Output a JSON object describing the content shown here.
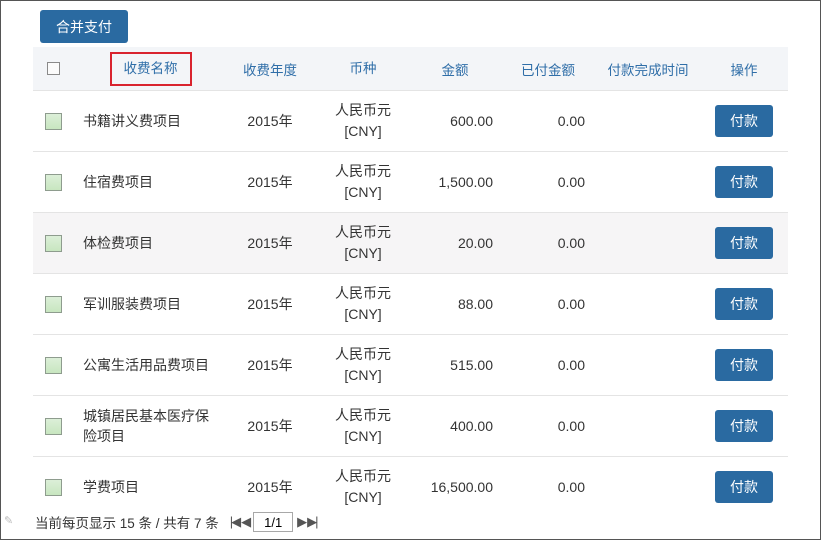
{
  "toolbar": {
    "merge_pay_label": "合并支付"
  },
  "table": {
    "headers": {
      "name": "收费名称",
      "year": "收费年度",
      "currency": "币种",
      "amount": "金额",
      "paid": "已付金额",
      "paid_time": "付款完成时间",
      "action": "操作"
    },
    "rows": [
      {
        "name": "书籍讲义费项目",
        "year": "2015年",
        "currency_line1": "人民币元",
        "currency_line2": "[CNY]",
        "amount": "600.00",
        "paid": "0.00",
        "paid_time": "",
        "pay_label": "付款"
      },
      {
        "name": "住宿费项目",
        "year": "2015年",
        "currency_line1": "人民币元",
        "currency_line2": "[CNY]",
        "amount": "1,500.00",
        "paid": "0.00",
        "paid_time": "",
        "pay_label": "付款"
      },
      {
        "name": "体检费项目",
        "year": "2015年",
        "currency_line1": "人民币元",
        "currency_line2": "[CNY]",
        "amount": "20.00",
        "paid": "0.00",
        "paid_time": "",
        "pay_label": "付款"
      },
      {
        "name": "军训服装费项目",
        "year": "2015年",
        "currency_line1": "人民币元",
        "currency_line2": "[CNY]",
        "amount": "88.00",
        "paid": "0.00",
        "paid_time": "",
        "pay_label": "付款"
      },
      {
        "name": "公寓生活用品费项目",
        "year": "2015年",
        "currency_line1": "人民币元",
        "currency_line2": "[CNY]",
        "amount": "515.00",
        "paid": "0.00",
        "paid_time": "",
        "pay_label": "付款"
      },
      {
        "name_line1": "城镇居民基本医疗保",
        "name_line2": "险项目",
        "year": "2015年",
        "currency_line1": "人民币元",
        "currency_line2": "[CNY]",
        "amount": "400.00",
        "paid": "0.00",
        "paid_time": "",
        "pay_label": "付款"
      },
      {
        "name": "学费项目",
        "year": "2015年",
        "currency_line1": "人民币元",
        "currency_line2": "[CNY]",
        "amount": "16,500.00",
        "paid": "0.00",
        "paid_time": "",
        "pay_label": "付款"
      }
    ]
  },
  "footer": {
    "summary": "当前每页显示 15 条 / 共有 7 条",
    "page_value": "1/1"
  },
  "colors": {
    "accent": "#2a6aa1",
    "header_text": "#2f6ea8",
    "highlight_border": "#d9232e"
  }
}
